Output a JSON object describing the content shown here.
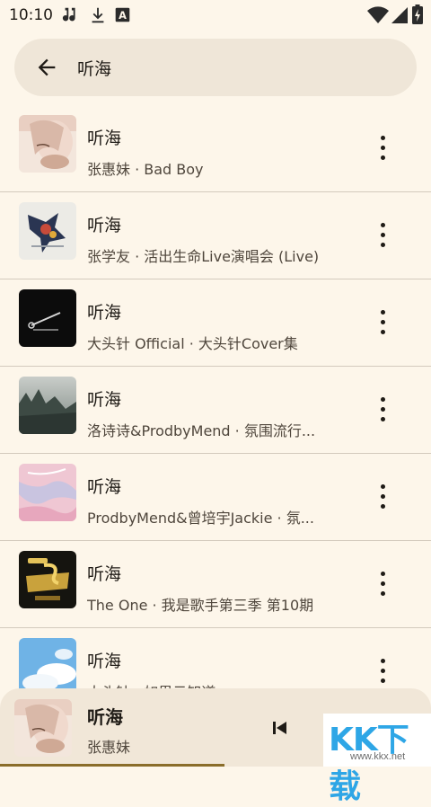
{
  "status_bar": {
    "time": "10:10",
    "icons": [
      "music-note-icon",
      "download-icon",
      "a-letter-icon",
      "wifi-icon",
      "signal-icon",
      "battery-icon"
    ],
    "a_glyph": "A"
  },
  "search": {
    "query": "听海",
    "back_icon": "arrow-back-icon"
  },
  "songs": [
    {
      "title": "听海",
      "subtitle": "张惠妹 · Bad Boy"
    },
    {
      "title": "听海",
      "subtitle": "张学友 · 活出生命Live演唱会 (Live)"
    },
    {
      "title": "听海",
      "subtitle": "大头针 Official · 大头针Cover集"
    },
    {
      "title": "听海",
      "subtitle": "洛诗诗&ProdbyMend · 氛围流行..."
    },
    {
      "title": "听海",
      "subtitle": "ProdbyMend&曾培宇Jackie · 氛..."
    },
    {
      "title": "听海",
      "subtitle": "The One · 我是歌手第三季 第10期"
    },
    {
      "title": "听海",
      "subtitle": "大头针 · 如果云知道"
    }
  ],
  "player": {
    "title": "听海",
    "artist": "张惠妹",
    "prev_icon": "skip-previous-icon",
    "progress": 0.52
  },
  "watermark": {
    "logo": "KK下载",
    "url": "www.kkx.net"
  },
  "colors": {
    "background": "#fdf6ea",
    "search_bar": "#efe6d8",
    "player_bar": "#f1e7d8",
    "progress": "#8a6d2a",
    "watermark_blue": "#2ea6e6"
  }
}
